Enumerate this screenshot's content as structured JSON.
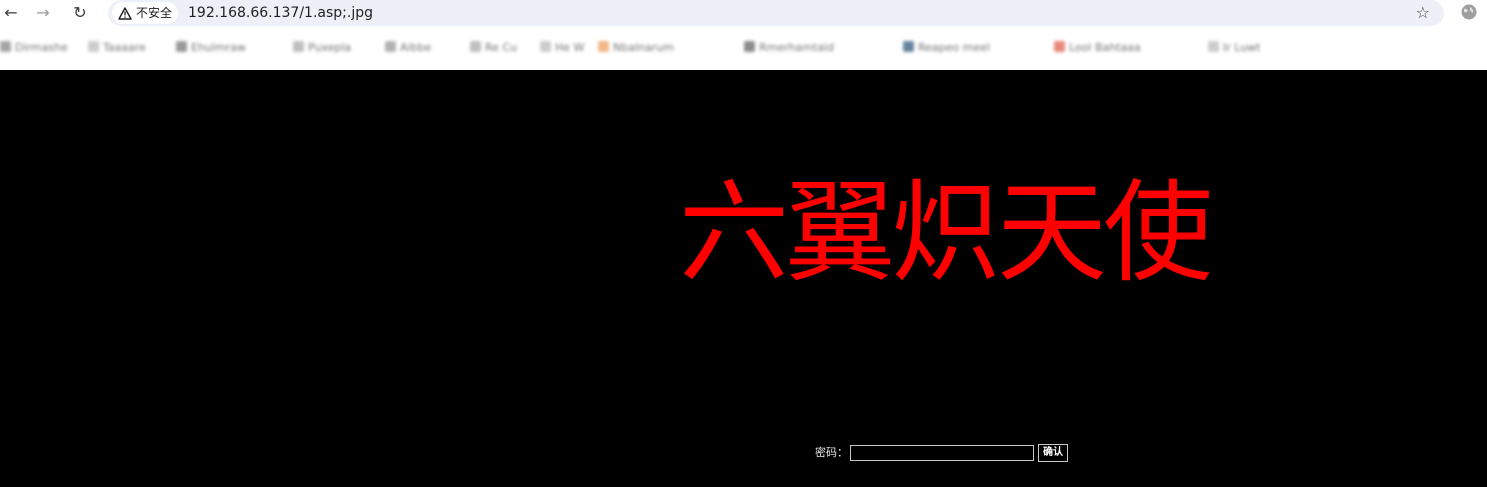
{
  "browser": {
    "security_label": "不安全",
    "url": "192.168.66.137/1.asp;.jpg",
    "icons": {
      "back": "back-arrow-icon",
      "forward": "forward-arrow-icon",
      "reload": "reload-icon",
      "warning": "warning-triangle-icon",
      "star": "star-icon",
      "profile": "globe-icon"
    },
    "bookmarks": [
      {
        "label": "Dirmashe"
      },
      {
        "label": "Taaaare"
      },
      {
        "label": "Ehulmraw"
      },
      {
        "label": "Puxepla"
      },
      {
        "label": "Aibbe"
      },
      {
        "label": "Re Cu"
      },
      {
        "label": "He W"
      },
      {
        "label": "Nbalnarum"
      },
      {
        "label": "Rmerhamtald"
      },
      {
        "label": "Reapeo meel"
      },
      {
        "label": "Lool Bahtaaa"
      },
      {
        "label": "Ir Luwt"
      }
    ]
  },
  "page": {
    "banner_text": "六翼炽天使",
    "password_label": "密码：",
    "password_value": "",
    "submit_label": "确认",
    "colors": {
      "background": "#000000",
      "banner": "#ff0000"
    }
  }
}
